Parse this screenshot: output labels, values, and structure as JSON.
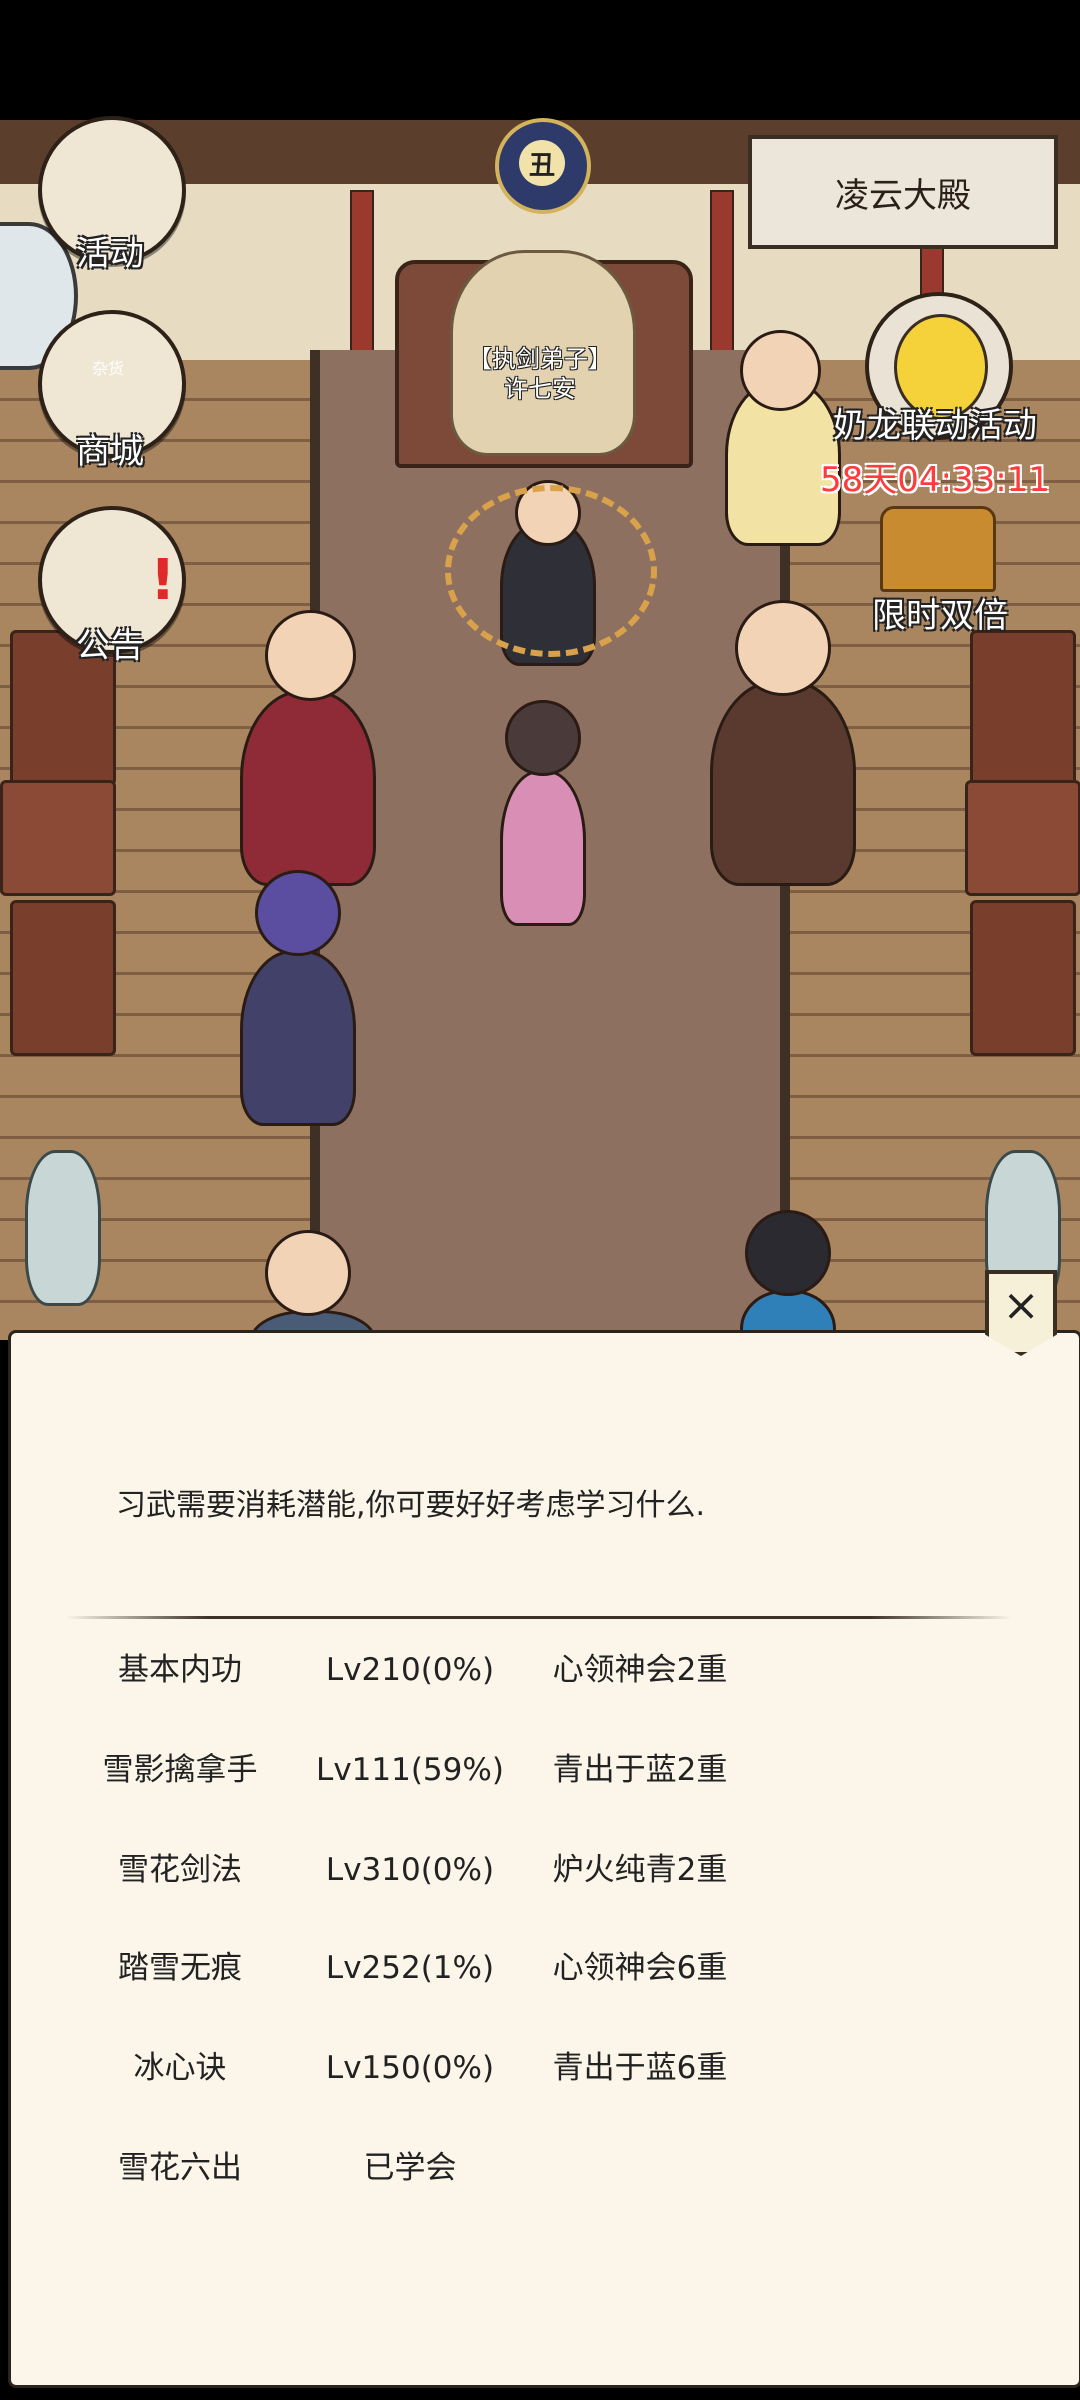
{
  "hud": {
    "hall_name": "凌云大殿",
    "time_glyph": "丑",
    "buttons": [
      {
        "id": "activity",
        "label": "活动"
      },
      {
        "id": "shop",
        "label": "商城",
        "sign": "杂货"
      },
      {
        "id": "notice",
        "label": "公告"
      }
    ],
    "event": {
      "label": "奶龙联动活动",
      "timer": "58天04:33:11"
    },
    "double": {
      "label": "限时双倍"
    }
  },
  "npc": {
    "title": "【执剑弟子】",
    "name": "许七安"
  },
  "dialog": {
    "close_glyph": "×",
    "prompt": "习武需要消耗潜能,你可要好好考虑学习什么.",
    "skills": [
      {
        "name": "基本内功",
        "level": "Lv210(0%)",
        "realm": "心领神会2重"
      },
      {
        "name": "雪影擒拿手",
        "level": "Lv111(59%)",
        "realm": "青出于蓝2重"
      },
      {
        "name": "雪花剑法",
        "level": "Lv310(0%)",
        "realm": "炉火纯青2重"
      },
      {
        "name": "踏雪无痕",
        "level": "Lv252(1%)",
        "realm": "心领神会6重"
      },
      {
        "name": "冰心诀",
        "level": "Lv150(0%)",
        "realm": "青出于蓝6重"
      },
      {
        "name": "雪花六出",
        "level": "已学会",
        "realm": ""
      }
    ]
  }
}
